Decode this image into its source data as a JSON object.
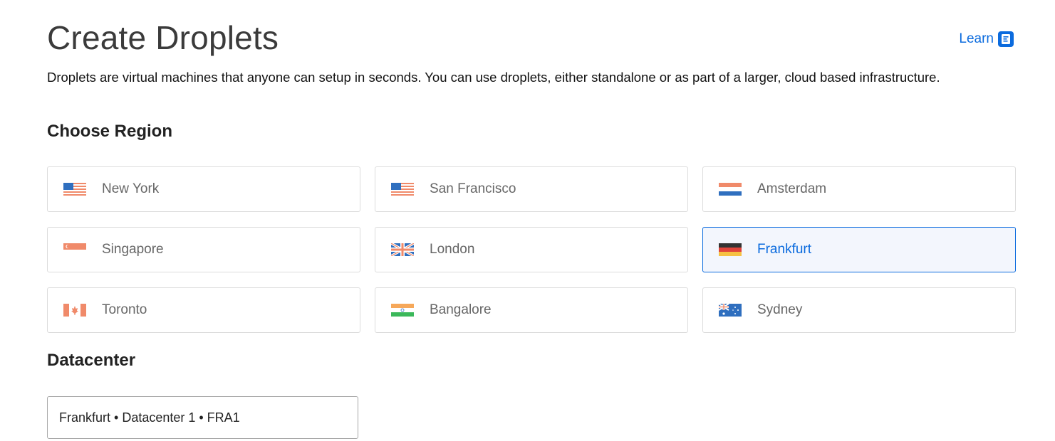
{
  "header": {
    "title": "Create Droplets",
    "learn_label": "Learn",
    "learn_icon": "document-icon",
    "intro": "Droplets are virtual machines that anyone can setup in seconds. You can use droplets, either standalone or as part of a larger, cloud based infrastructure."
  },
  "region": {
    "heading": "Choose Region",
    "selected": "Frankfurt",
    "items": [
      {
        "label": "New York",
        "flag": "us-flag-icon"
      },
      {
        "label": "San Francisco",
        "flag": "us-flag-icon"
      },
      {
        "label": "Amsterdam",
        "flag": "nl-flag-icon"
      },
      {
        "label": "Singapore",
        "flag": "sg-flag-icon"
      },
      {
        "label": "London",
        "flag": "uk-flag-icon"
      },
      {
        "label": "Frankfurt",
        "flag": "de-flag-icon"
      },
      {
        "label": "Toronto",
        "flag": "ca-flag-icon"
      },
      {
        "label": "Bangalore",
        "flag": "in-flag-icon"
      },
      {
        "label": "Sydney",
        "flag": "au-flag-icon"
      }
    ]
  },
  "datacenter": {
    "heading": "Datacenter",
    "value": "Frankfurt • Datacenter 1 • FRA1"
  },
  "colors": {
    "accent": "#0b6bde",
    "selected_bg": "#f3f6fd",
    "card_border": "#dcdcdc"
  }
}
